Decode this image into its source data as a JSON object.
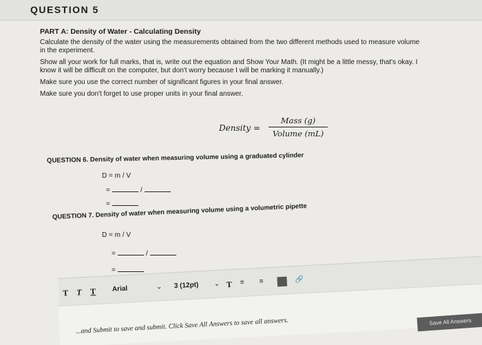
{
  "question_label": "QUESTION 5",
  "part_title": "PART A: Density of Water - Calculating Density",
  "instructions": [
    "Calculate the density of the water using the measurements obtained from the two different methods used to measure volume",
    "in the experiment.",
    "Show all your work for full marks, that is, write out the equation and Show Your Math. (It might be a little messy, that's okay. I",
    "know it will be difficult on the computer, but don't worry because I will be marking it manually.)",
    "Make sure you use the correct number of significant figures in your final answer.",
    "Make sure you don't forget to use proper units in your final answer."
  ],
  "formula": {
    "lhs": "Density =",
    "numerator": "Mass (g)",
    "denominator": "Volume (mL)"
  },
  "question6": {
    "title": "QUESTION 6. Density of water when measuring volume using a graduated cylinder",
    "line1": "D = m / V",
    "line2_prefix": "=",
    "line2_sep": "/",
    "line3_prefix": "="
  },
  "question7": {
    "title": "QUESTION 7. Density of water when measuring volume using a volumetric pipette",
    "line1": "D = m / V",
    "line2_prefix": "=",
    "line2_sep": "/",
    "line3_prefix": "="
  },
  "toolbar": {
    "bold": "T",
    "italic": "T",
    "underline": "T",
    "font": "Arial",
    "size": "3 (12pt)",
    "text_color": "T",
    "right_icons": "☑ / ⌘ ≡"
  },
  "footer_note": "...and Submit to save and submit. Click Save All Answers to save all answers.",
  "save_all_button": "Save All Answers"
}
